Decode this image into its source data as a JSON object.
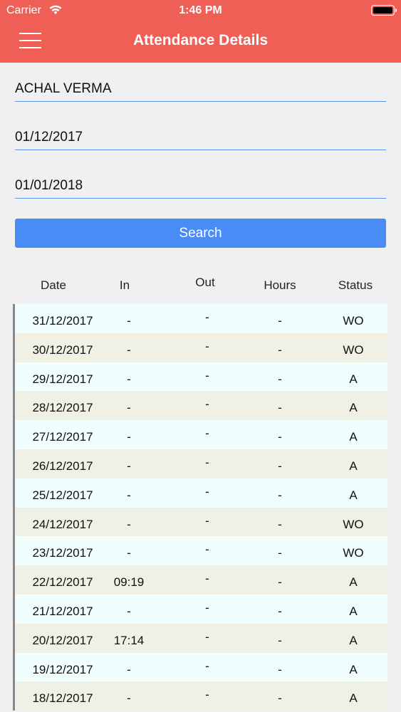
{
  "status_bar": {
    "carrier": "Carrier",
    "time": "1:46 PM"
  },
  "header": {
    "title": "Attendance Details"
  },
  "form": {
    "employee": "ACHAL VERMA",
    "from_date": "01/12/2017",
    "to_date": "01/01/2018",
    "search_label": "Search"
  },
  "table": {
    "columns": [
      "Date",
      "In",
      "Out",
      "Hours",
      "Status"
    ],
    "rows": [
      {
        "date": "31/12/2017",
        "in": "-",
        "out": "-",
        "hours": "-",
        "status": "WO"
      },
      {
        "date": "30/12/2017",
        "in": "-",
        "out": "-",
        "hours": "-",
        "status": "WO"
      },
      {
        "date": "29/12/2017",
        "in": "-",
        "out": "-",
        "hours": "-",
        "status": "A"
      },
      {
        "date": "28/12/2017",
        "in": "-",
        "out": "-",
        "hours": "-",
        "status": "A"
      },
      {
        "date": "27/12/2017",
        "in": "-",
        "out": "-",
        "hours": "-",
        "status": "A"
      },
      {
        "date": "26/12/2017",
        "in": "-",
        "out": "-",
        "hours": "-",
        "status": "A"
      },
      {
        "date": "25/12/2017",
        "in": "-",
        "out": "-",
        "hours": "-",
        "status": "A"
      },
      {
        "date": "24/12/2017",
        "in": "-",
        "out": "-",
        "hours": "-",
        "status": "WO"
      },
      {
        "date": "23/12/2017",
        "in": "-",
        "out": "-",
        "hours": "-",
        "status": "WO"
      },
      {
        "date": "22/12/2017",
        "in": "09:19",
        "out": "-",
        "hours": "-",
        "status": "A"
      },
      {
        "date": "21/12/2017",
        "in": "-",
        "out": "-",
        "hours": "-",
        "status": "A"
      },
      {
        "date": "20/12/2017",
        "in": "17:14",
        "out": "-",
        "hours": "-",
        "status": "A"
      },
      {
        "date": "19/12/2017",
        "in": "-",
        "out": "-",
        "hours": "-",
        "status": "A"
      },
      {
        "date": "18/12/2017",
        "in": "-",
        "out": "-",
        "hours": "-",
        "status": "A"
      }
    ]
  },
  "colors": {
    "header": "#f05f55",
    "button": "#4a8cf6",
    "underline": "#5b95e8",
    "row_even": "#f0fffd",
    "row_odd": "#f1f0e4"
  },
  "icons": {
    "menu": "hamburger-menu-icon",
    "wifi": "wifi-icon",
    "battery": "battery-icon"
  }
}
